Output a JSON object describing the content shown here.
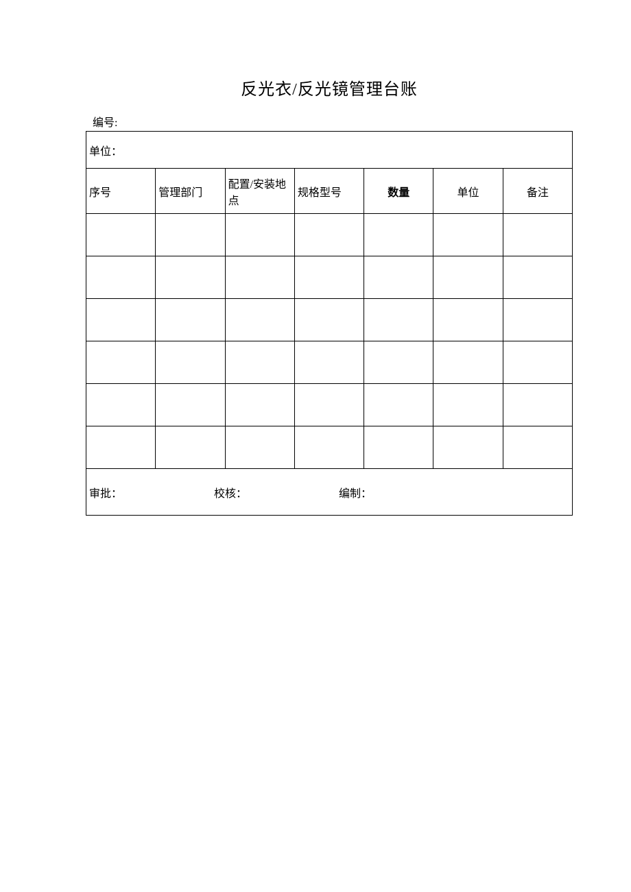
{
  "title": "反光衣/反光镜管理台账",
  "serial_label": "编号:",
  "unit_label": "单位：",
  "headers": {
    "seq": "序号",
    "dept": "管理部门",
    "loc": "配置/安装地点",
    "spec": "规格型号",
    "qty": "数量",
    "unit": "单位",
    "remark": "备注"
  },
  "rows": [
    {
      "seq": "",
      "dept": "",
      "loc": "",
      "spec": "",
      "qty": "",
      "unit": "",
      "remark": ""
    },
    {
      "seq": "",
      "dept": "",
      "loc": "",
      "spec": "",
      "qty": "",
      "unit": "",
      "remark": ""
    },
    {
      "seq": "",
      "dept": "",
      "loc": "",
      "spec": "",
      "qty": "",
      "unit": "",
      "remark": ""
    },
    {
      "seq": "",
      "dept": "",
      "loc": "",
      "spec": "",
      "qty": "",
      "unit": "",
      "remark": ""
    },
    {
      "seq": "",
      "dept": "",
      "loc": "",
      "spec": "",
      "qty": "",
      "unit": "",
      "remark": ""
    },
    {
      "seq": "",
      "dept": "",
      "loc": "",
      "spec": "",
      "qty": "",
      "unit": "",
      "remark": ""
    }
  ],
  "footer": {
    "approve": "审批：",
    "check": "校核：",
    "compile": "编制："
  }
}
